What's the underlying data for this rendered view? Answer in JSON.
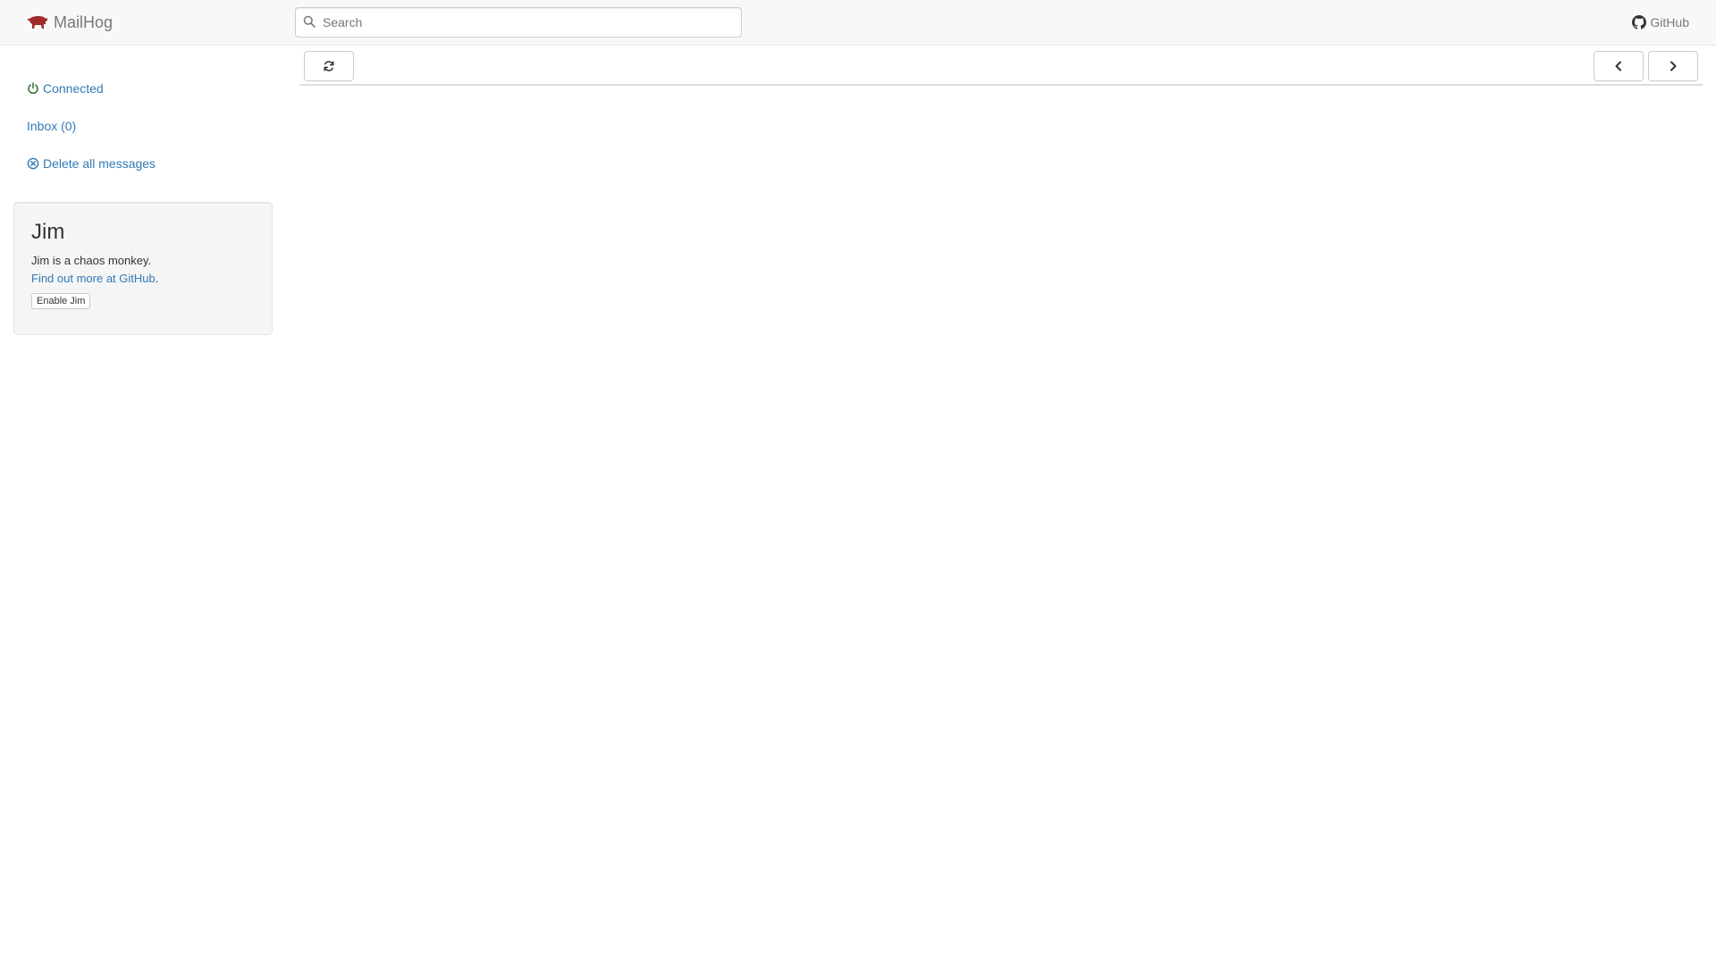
{
  "navbar": {
    "brand": "MailHog",
    "search_placeholder": "Search",
    "github_label": "GitHub"
  },
  "sidebar": {
    "connected_label": "Connected",
    "inbox_label": "Inbox (0)",
    "delete_label": "Delete all messages"
  },
  "jim": {
    "title": "Jim",
    "description": "Jim is a chaos monkey.",
    "more_link": "Find out more at GitHub",
    "more_suffix": ".",
    "enable_label": "Enable Jim"
  },
  "colors": {
    "link": "#337ab7",
    "connected": "#3c763d",
    "logo": "#a02c2c",
    "navbar_bg": "#f8f8f8"
  },
  "icons": {
    "logo": "pig-logo-icon",
    "search": "search-icon",
    "github": "github-icon",
    "connected": "power-icon",
    "delete": "remove-circle-icon",
    "refresh": "refresh-icon",
    "prev": "chevron-left-icon",
    "next": "chevron-right-icon"
  }
}
